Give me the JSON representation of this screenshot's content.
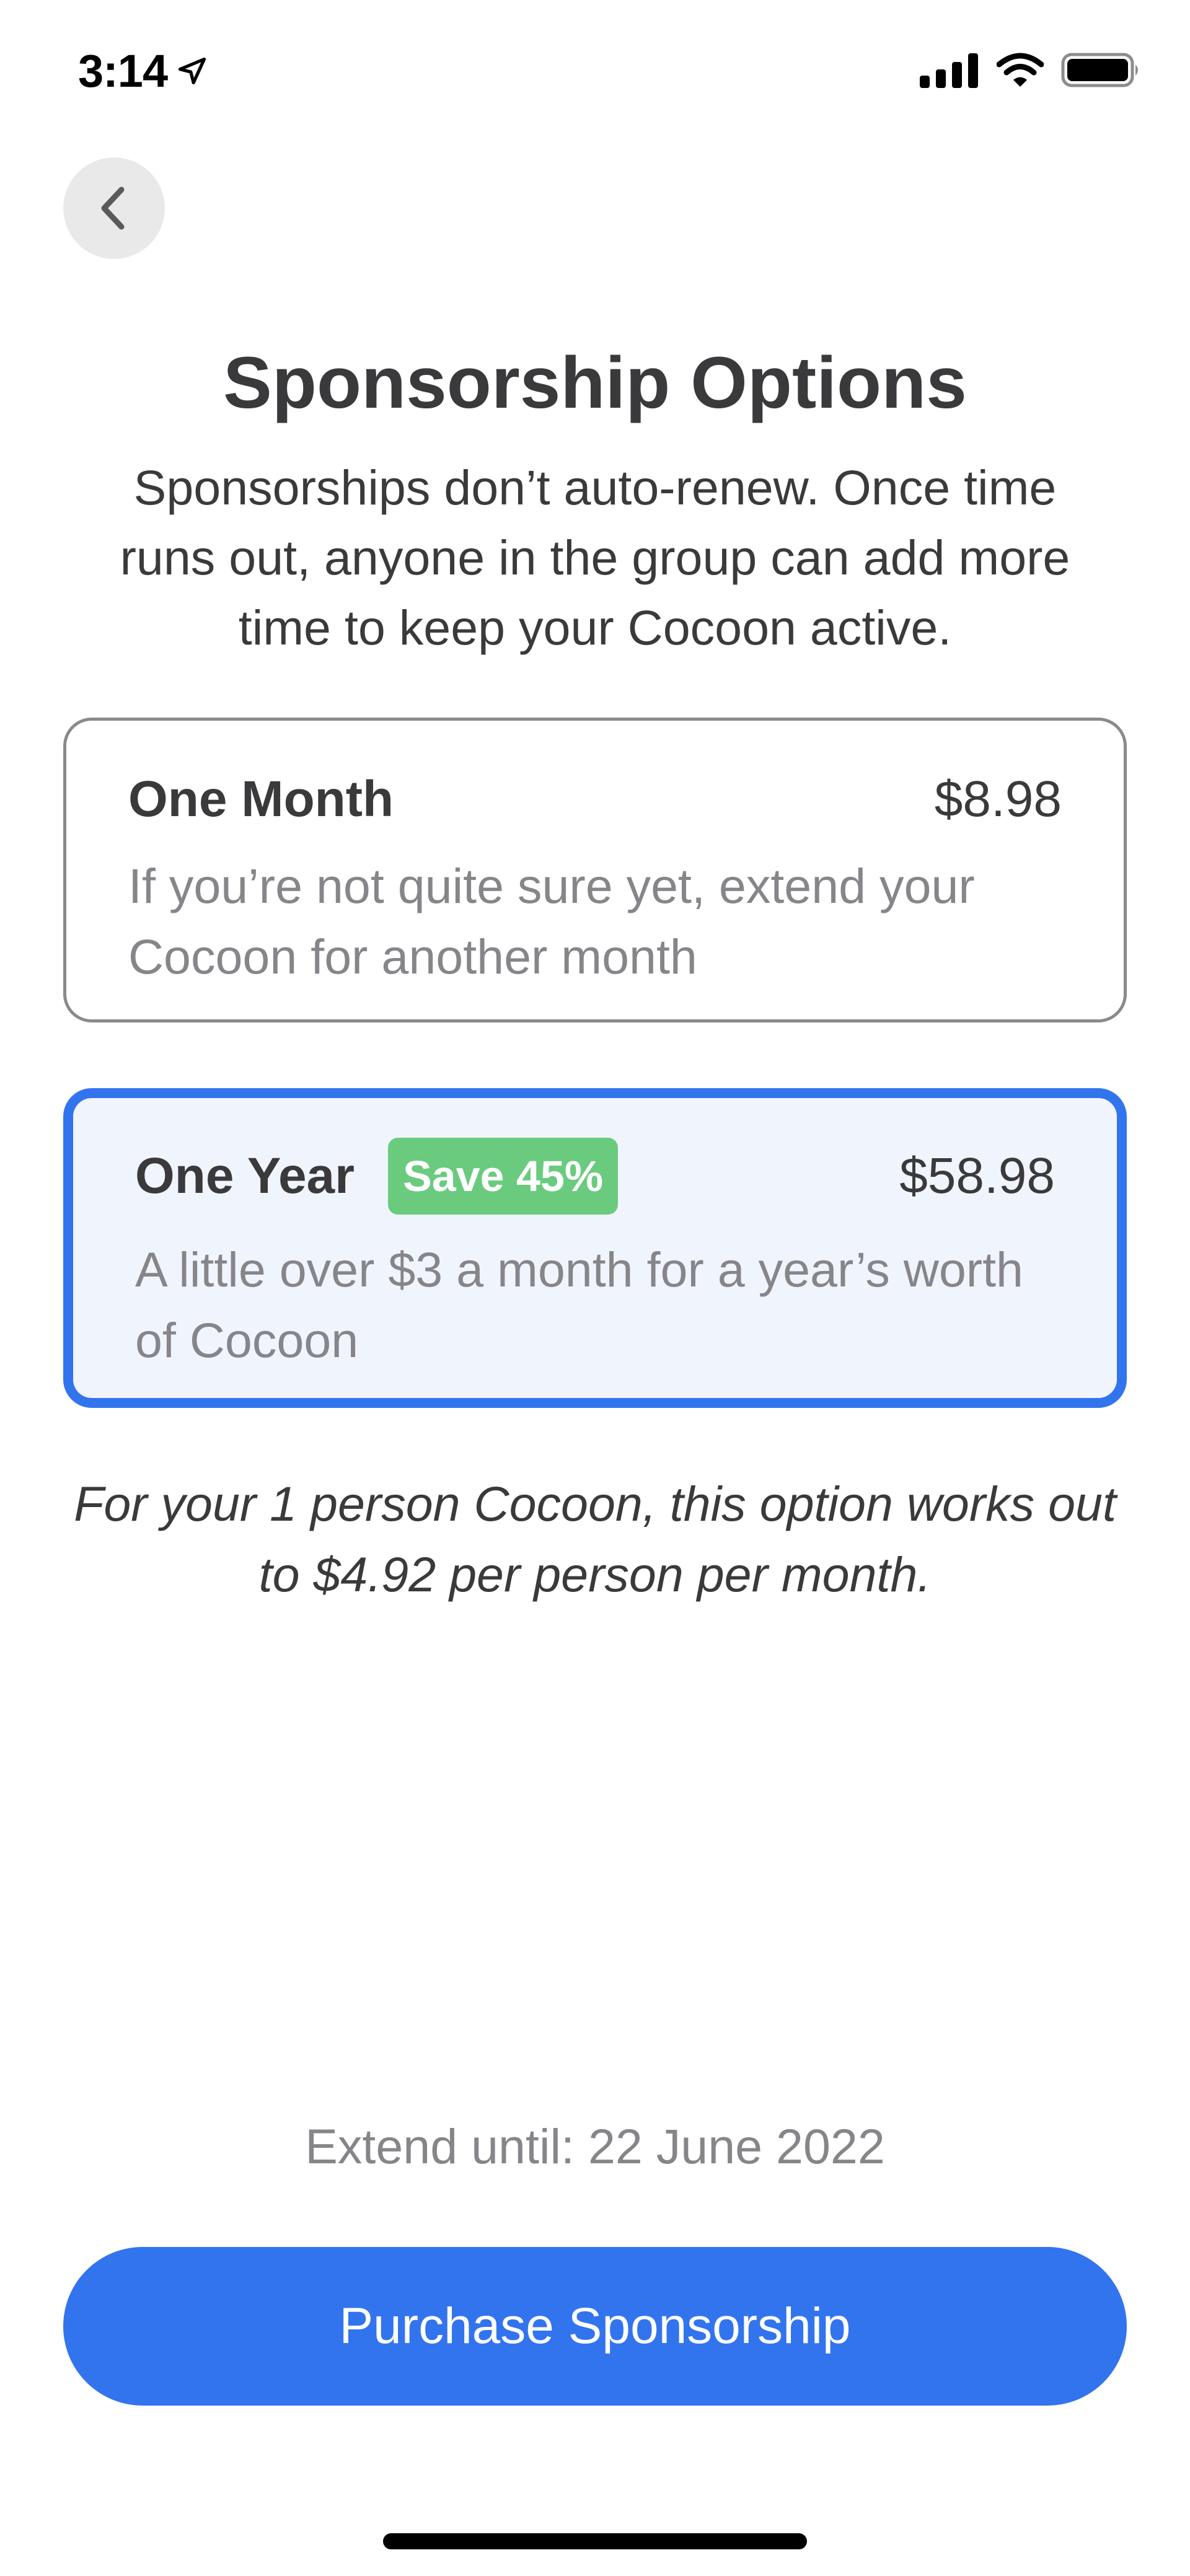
{
  "status_bar": {
    "time": "3:14",
    "icons": [
      "location-arrow-icon",
      "cellular-signal-icon",
      "wifi-icon",
      "battery-icon"
    ]
  },
  "header": {
    "back_icon": "chevron-left-icon",
    "title": "Sponsorship Options",
    "subtitle": "Sponsorships don’t auto-renew. Once time runs out, anyone in the group can add more time to keep your Cocoon active."
  },
  "options": [
    {
      "name": "One Month",
      "price": "$8.98",
      "description": "If you’re not quite sure yet, extend your Cocoon for another month",
      "selected": false
    },
    {
      "name": "One Year",
      "badge": "Save 45%",
      "price": "$58.98",
      "description": "A little over $3 a month for a year’s worth of Cocoon",
      "selected": true
    }
  ],
  "note": "For your 1 person Cocoon, this option works out to $4.92 per person per month.",
  "footer": {
    "extend_text": "Extend until: 22 June 2022",
    "purchase_label": "Purchase Sponsorship"
  },
  "colors": {
    "accent": "#3274ee",
    "badge": "#6acb7f",
    "selected_background": "#f0f5fd",
    "secondary_text": "#86868a",
    "primary_text": "#3a3a3c"
  }
}
